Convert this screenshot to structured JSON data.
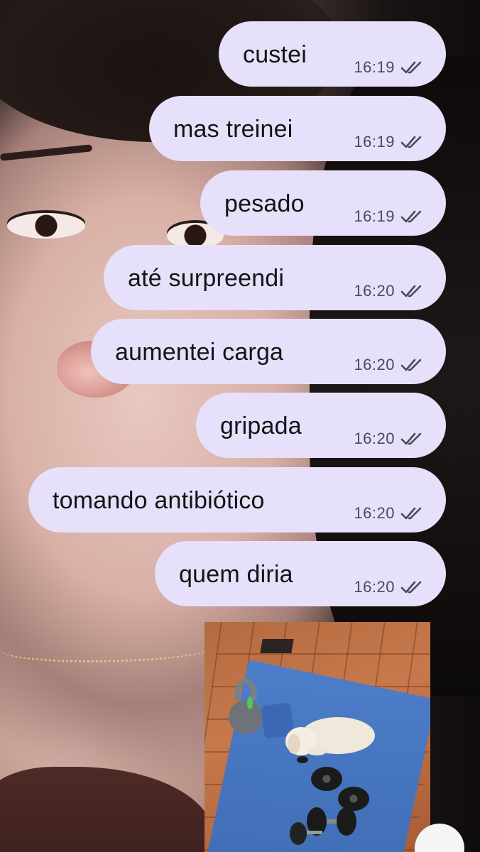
{
  "messages": [
    {
      "text": "custei",
      "time": "16:19"
    },
    {
      "text": "mas treinei",
      "time": "16:19"
    },
    {
      "text": "pesado",
      "time": "16:19"
    },
    {
      "text": "até surpreendi",
      "time": "16:20"
    },
    {
      "text": "aumentei carga",
      "time": "16:20"
    },
    {
      "text": "gripada",
      "time": "16:20"
    },
    {
      "text": "tomando antibiótico",
      "time": "16:20"
    },
    {
      "text": "quem diria",
      "time": "16:20"
    }
  ],
  "read_receipt_icon": "double-check-icon",
  "colors": {
    "bubble": "#e6e0fb",
    "text": "#141414",
    "time": "#4a4a55"
  }
}
